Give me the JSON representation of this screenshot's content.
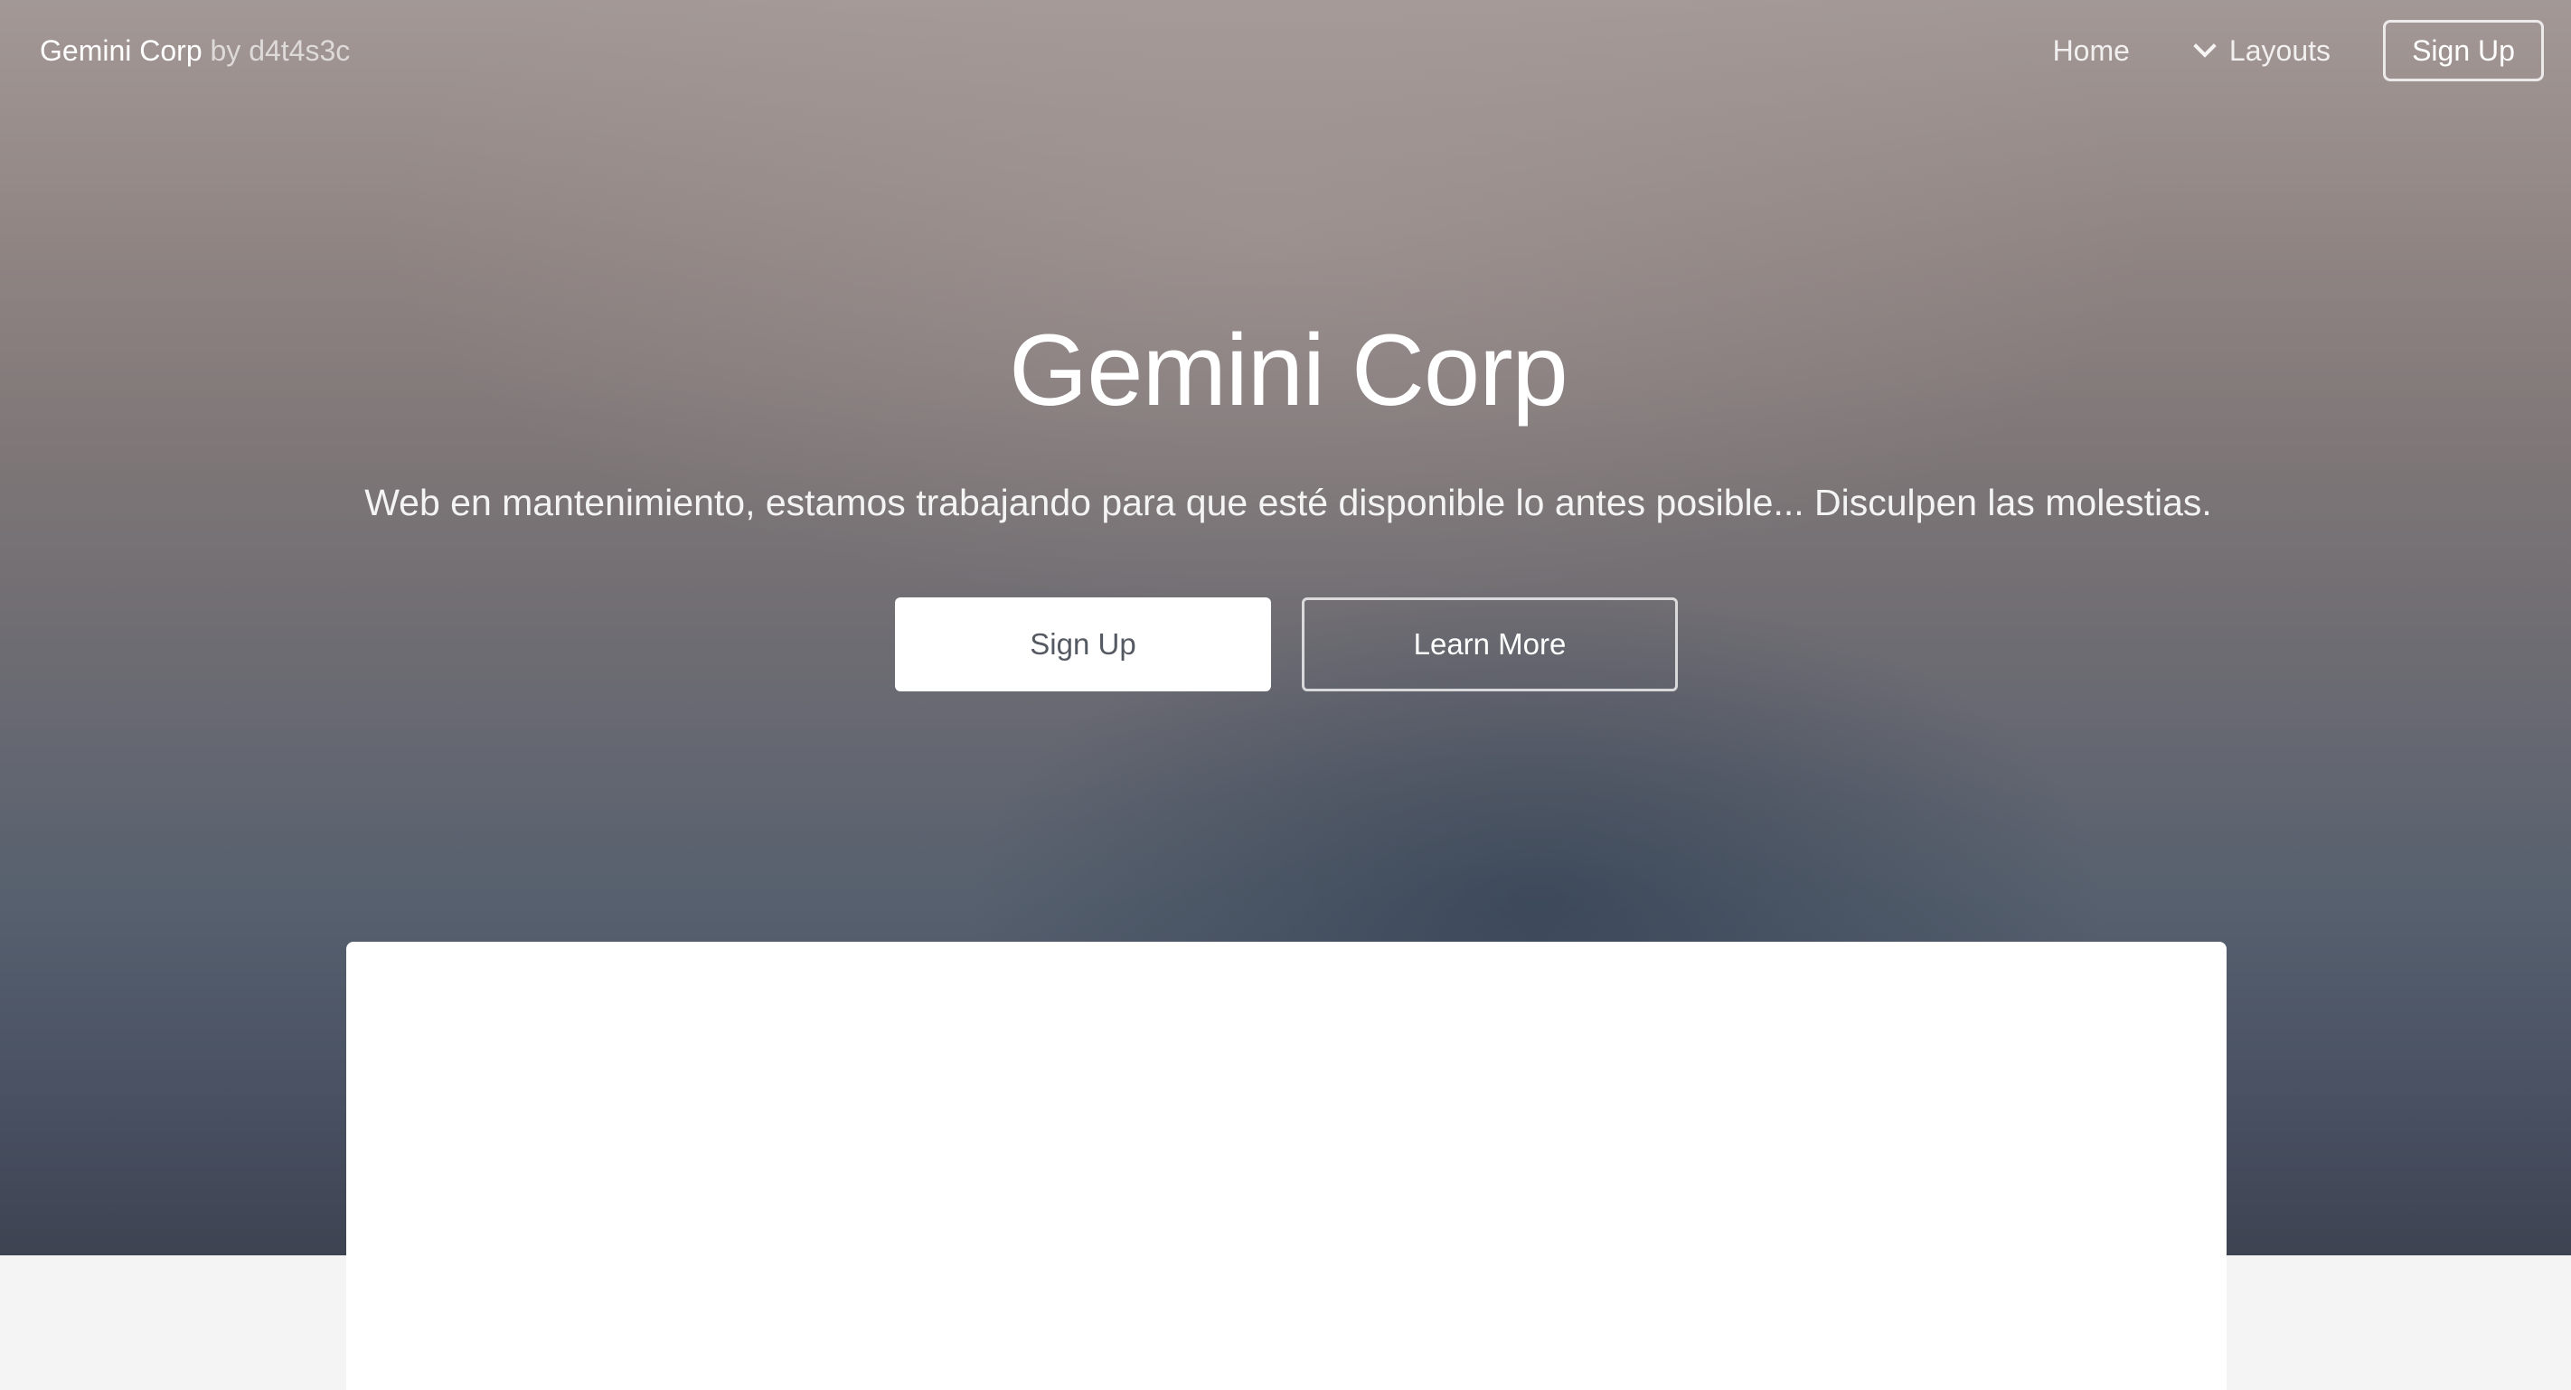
{
  "nav": {
    "brand_name": "Gemini Corp",
    "brand_by": "by d4t4s3c",
    "home_label": "Home",
    "layouts_label": "Layouts",
    "layouts_icon": "chevron-down-icon",
    "signup_label": "Sign Up"
  },
  "hero": {
    "title": "Gemini Corp",
    "subtitle": "Web en mantenimiento, estamos trabajando para que esté disponible lo antes posible... Disculpen las molestias.",
    "primary_button": "Sign Up",
    "secondary_button": "Learn More"
  },
  "colors": {
    "hero_top": "#a39896",
    "hero_bottom": "#3e4352",
    "page_background": "#f4f4f4",
    "panel_background": "#ffffff"
  }
}
